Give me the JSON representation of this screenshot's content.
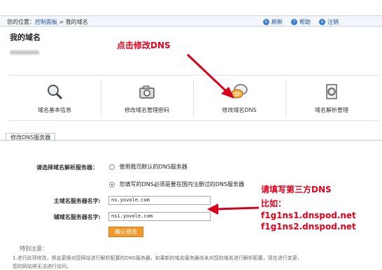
{
  "breadcrumb": {
    "prefix": "您的位置：",
    "link": "控制面板",
    "separator": " > ",
    "current": "我的域名"
  },
  "toplinks": [
    {
      "icon": "refresh-icon",
      "label": "刷新"
    },
    {
      "icon": "help-icon",
      "label": "帮助"
    },
    {
      "icon": "logout-icon",
      "label": "注销"
    }
  ],
  "page_title": "我的域名",
  "annotation_top": "点击修改DNS",
  "tiles": [
    {
      "icon": "magnifier-icon",
      "label": "域名基本信息"
    },
    {
      "icon": "camera-icon",
      "label": "修改域名管理密码"
    },
    {
      "icon": "dns-chat-icon",
      "label": "修改域名DNS"
    },
    {
      "icon": "settings-icon",
      "label": "域名解析管理"
    }
  ],
  "tab": {
    "label": "修改DNS服务器"
  },
  "form": {
    "select_label": "请选择域名解析服务器：",
    "option_default": "使用我司默认的DNS服务器",
    "option_custom": "您填写的DNS必须是要在国内注册过的DNS服务器",
    "primary_label": "主域名服务器名字:",
    "primary_value": "ns.yovole.com",
    "secondary_label": "辅域名服务器名字:",
    "secondary_value": "ns1.yovole.com",
    "confirm_button": "确认修改"
  },
  "notes": {
    "title": "特别注意：",
    "line1": "1.进行此项修改，将会更换对您网站进行解析配置的DNS服务器，如果新的域名服务器尚未对您的域名进行解析配置，现在进行变更，",
    "line2": "您的网站将无法进行访问。"
  },
  "annotation_right": {
    "heading": "请填写第三方DNS",
    "example": "比如：",
    "dns1": "f1g1ns1.dnspod.net",
    "dns2": "f1g1ns2.dnspod.net"
  },
  "colors": {
    "annotation_red": "#e2001a",
    "button_orange": "#f39a2b",
    "link_blue": "#1c4fa0"
  }
}
